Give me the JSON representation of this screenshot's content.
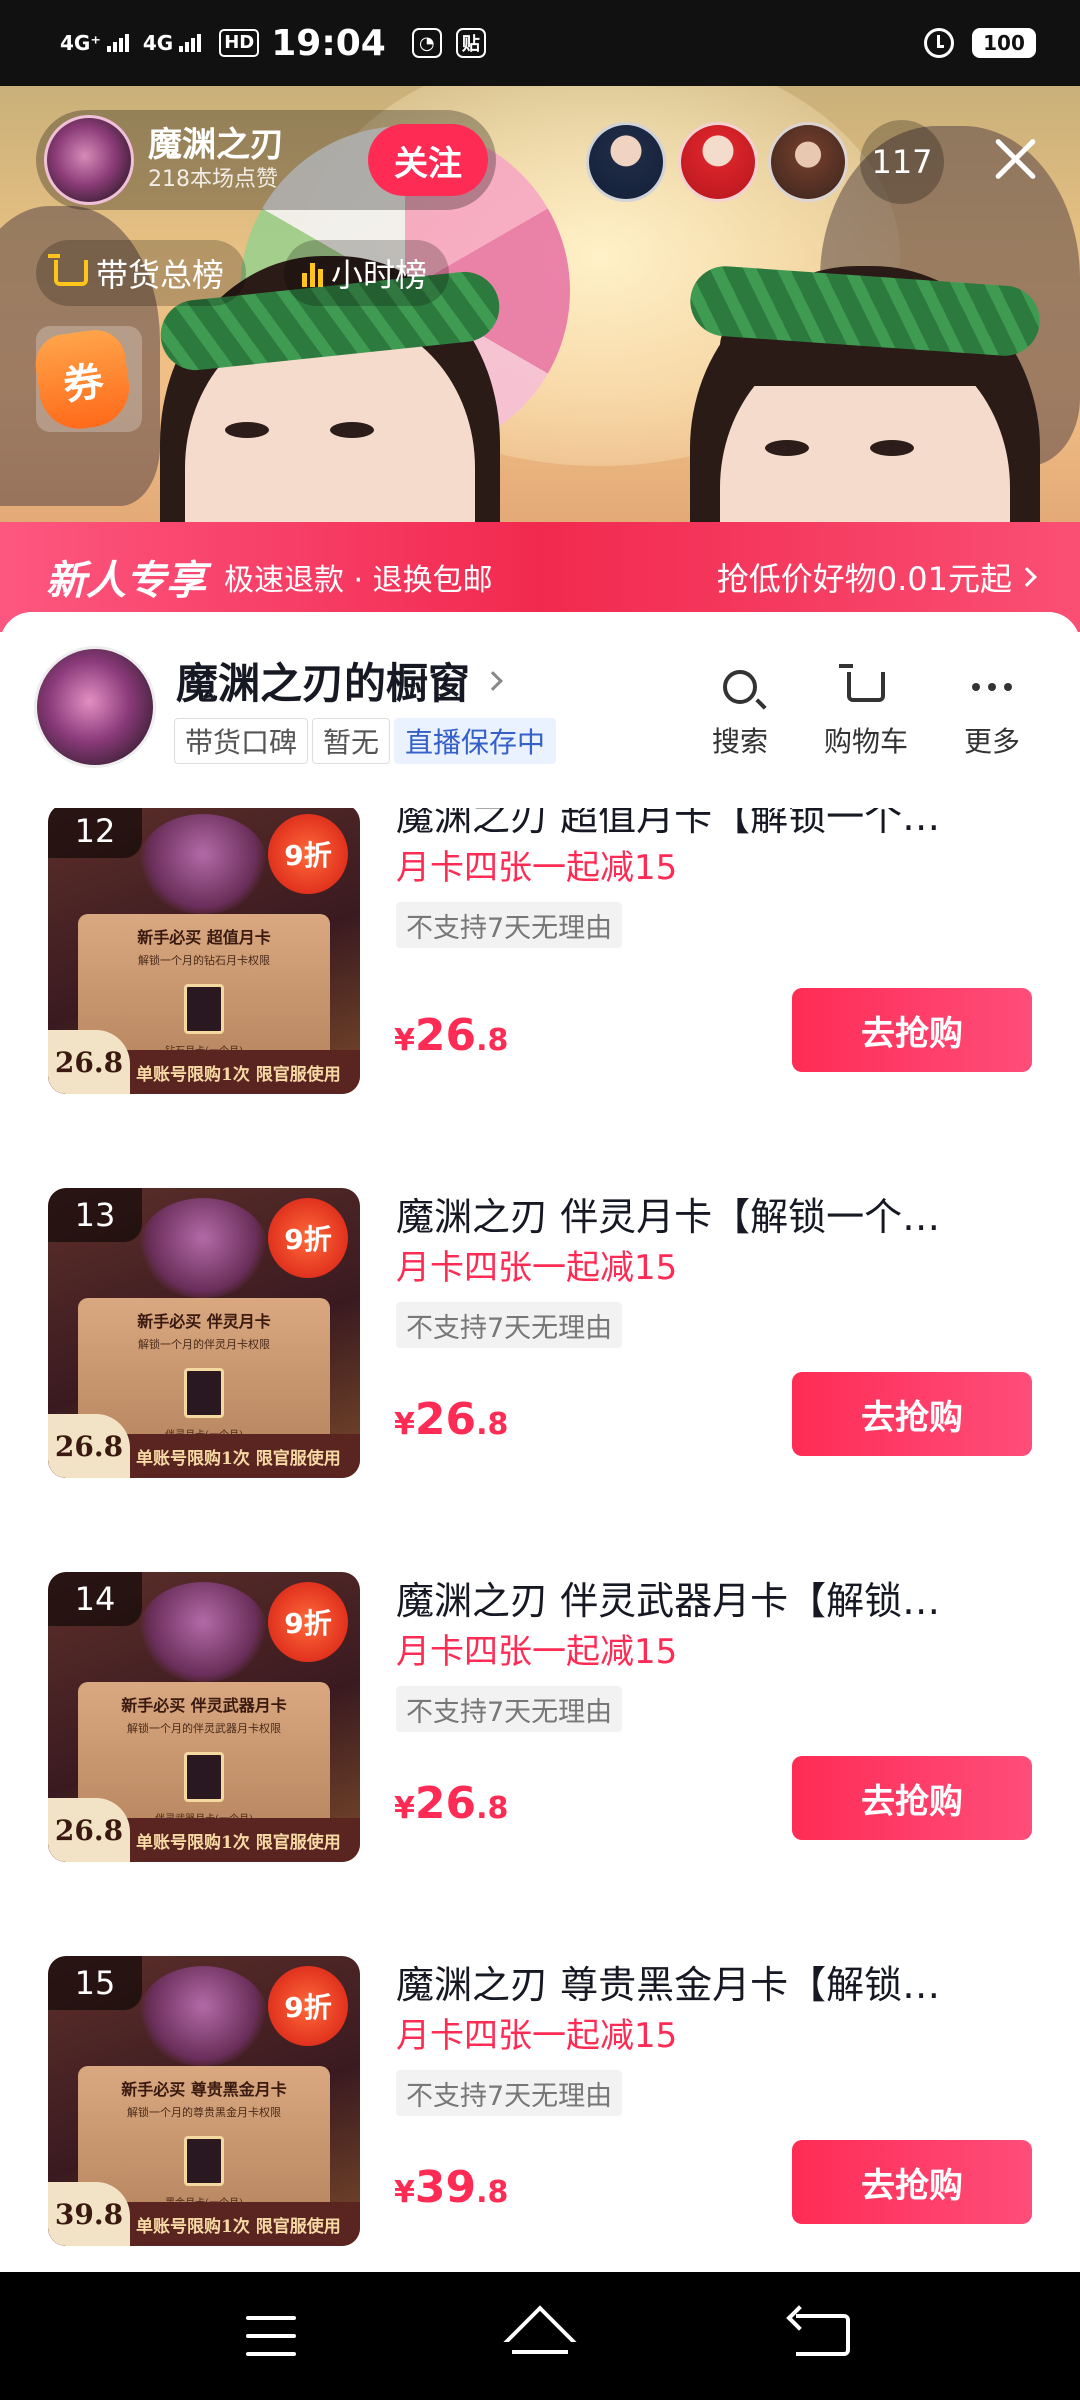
{
  "status_bar": {
    "network1": "4G⁺",
    "network2": "4G",
    "hd": "HD",
    "time": "19:04",
    "app_icon2": "贴",
    "battery": "100"
  },
  "live": {
    "anchor_name": "魔渊之刃",
    "likes": "218本场点赞",
    "follow_label": "关注",
    "viewer_count": "117",
    "rank_goods": "带货总榜",
    "rank_hour": "小时榜",
    "coupon_label": "券"
  },
  "promo": {
    "title": "新人专享",
    "subtitle": "极速退款 · 退换包邮",
    "right": "抢低价好物0.01元起"
  },
  "shop": {
    "name": "魔渊之刃的橱窗",
    "tags": [
      "带货口碑",
      "暂无",
      "直播保存中"
    ],
    "tools": {
      "search": "搜索",
      "cart": "购物车",
      "more": "更多"
    }
  },
  "products": [
    {
      "index": "12",
      "title": "魔渊之刃 超值月卡【解锁一个…",
      "promo": "月卡四张一起减15",
      "tag": "不支持7天无理由",
      "price_currency": "¥",
      "price_int": "26",
      "price_dec": ".8",
      "buy_label": "去抢购",
      "thumb_badge": "9折",
      "thumb_title": "新手必买 超值月卡",
      "thumb_desc": "解锁一个月的钻石月卡权限",
      "thumb_caption": "钻石月卡(一个月)",
      "thumb_price": "26.8",
      "thumb_bottom": "单账号限购1次 限官服使用"
    },
    {
      "index": "13",
      "title": "魔渊之刃 伴灵月卡【解锁一个…",
      "promo": "月卡四张一起减15",
      "tag": "不支持7天无理由",
      "price_currency": "¥",
      "price_int": "26",
      "price_dec": ".8",
      "buy_label": "去抢购",
      "thumb_badge": "9折",
      "thumb_title": "新手必买 伴灵月卡",
      "thumb_desc": "解锁一个月的伴灵月卡权限",
      "thumb_caption": "伴灵月卡(一个月)",
      "thumb_price": "26.8",
      "thumb_bottom": "单账号限购1次 限官服使用"
    },
    {
      "index": "14",
      "title": "魔渊之刃 伴灵武器月卡【解锁…",
      "promo": "月卡四张一起减15",
      "tag": "不支持7天无理由",
      "price_currency": "¥",
      "price_int": "26",
      "price_dec": ".8",
      "buy_label": "去抢购",
      "thumb_badge": "9折",
      "thumb_title": "新手必买 伴灵武器月卡",
      "thumb_desc": "解锁一个月的伴灵武器月卡权限",
      "thumb_caption": "伴灵武器月卡(一个月)",
      "thumb_price": "26.8",
      "thumb_bottom": "单账号限购1次 限官服使用"
    },
    {
      "index": "15",
      "title": "魔渊之刃 尊贵黑金月卡【解锁…",
      "promo": "月卡四张一起减15",
      "tag": "不支持7天无理由",
      "price_currency": "¥",
      "price_int": "39",
      "price_dec": ".8",
      "buy_label": "去抢购",
      "thumb_badge": "9折",
      "thumb_title": "新手必买 尊贵黑金月卡",
      "thumb_desc": "解锁一个月的尊贵黑金月卡权限",
      "thumb_caption": "黑金月卡(一个月)",
      "thumb_price": "39.8",
      "thumb_bottom": "单账号限购1次 限官服使用"
    }
  ],
  "colors": {
    "accent": "#fe2c55",
    "promo_start": "#fd5780",
    "rank_icon": "#ffc51a"
  },
  "icons": [
    "signal-icon",
    "alarm-icon",
    "battery-icon",
    "close-icon",
    "cart-icon",
    "bar-chart-icon",
    "search-icon",
    "more-icon",
    "menu-icon",
    "home-icon",
    "back-icon"
  ]
}
